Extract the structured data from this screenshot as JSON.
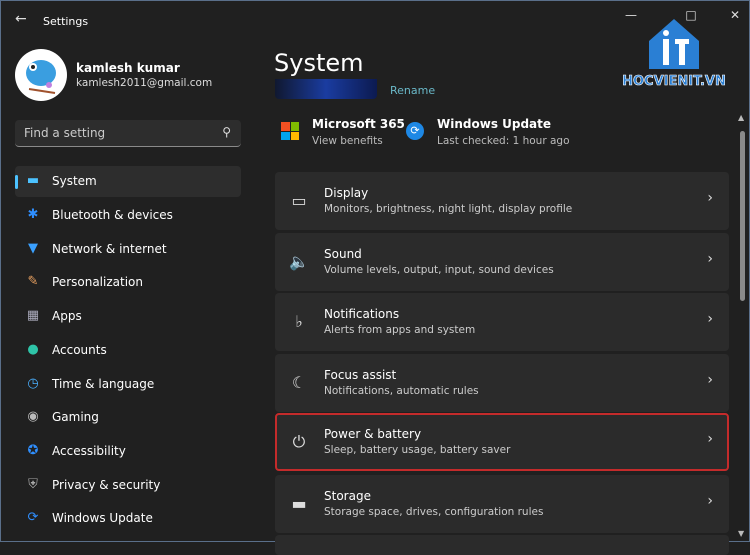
{
  "window": {
    "title": "Settings",
    "colors": {
      "accent": "#4cc2ff",
      "highlight": "#c42b2b"
    }
  },
  "user": {
    "name": "kamlesh kumar",
    "email": "kamlesh2011@gmail.com"
  },
  "search": {
    "placeholder": "Find a setting"
  },
  "sidebar": {
    "items": [
      {
        "label": "System",
        "icon": "monitor-icon",
        "active": true
      },
      {
        "label": "Bluetooth & devices",
        "icon": "bluetooth-icon"
      },
      {
        "label": "Network & internet",
        "icon": "wifi-icon"
      },
      {
        "label": "Personalization",
        "icon": "brush-icon"
      },
      {
        "label": "Apps",
        "icon": "apps-icon"
      },
      {
        "label": "Accounts",
        "icon": "person-icon"
      },
      {
        "label": "Time & language",
        "icon": "clock-globe-icon"
      },
      {
        "label": "Gaming",
        "icon": "gamepad-icon"
      },
      {
        "label": "Accessibility",
        "icon": "accessibility-icon"
      },
      {
        "label": "Privacy & security",
        "icon": "shield-icon"
      },
      {
        "label": "Windows Update",
        "icon": "update-icon"
      }
    ]
  },
  "main": {
    "title": "System",
    "rename": "Rename",
    "quick": [
      {
        "title": "Microsoft 365",
        "sub": "View benefits"
      },
      {
        "title": "Windows Update",
        "sub": "Last checked: 1 hour ago"
      }
    ],
    "cards": [
      {
        "title": "Display",
        "sub": "Monitors, brightness, night light, display profile",
        "icon": "display-icon"
      },
      {
        "title": "Sound",
        "sub": "Volume levels, output, input, sound devices",
        "icon": "speaker-icon"
      },
      {
        "title": "Notifications",
        "sub": "Alerts from apps and system",
        "icon": "bell-icon"
      },
      {
        "title": "Focus assist",
        "sub": "Notifications, automatic rules",
        "icon": "moon-icon"
      },
      {
        "title": "Power & battery",
        "sub": "Sleep, battery usage, battery saver",
        "icon": "power-icon",
        "highlighted": true
      },
      {
        "title": "Storage",
        "sub": "Storage space, drives, configuration rules",
        "icon": "storage-icon"
      }
    ]
  },
  "watermark": {
    "text": "HOCVIENIT.VN"
  }
}
